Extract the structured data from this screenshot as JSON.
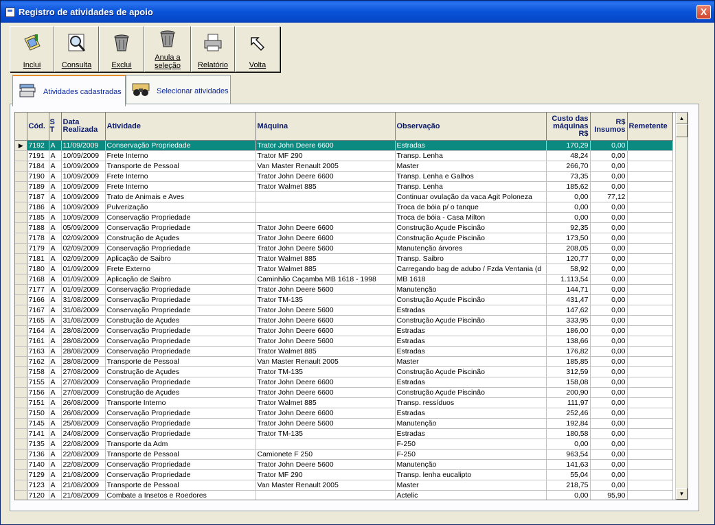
{
  "window": {
    "title": "Registro de atividades de apoio",
    "close_label": "X"
  },
  "toolbar": [
    {
      "label": "Inclui",
      "icon": "add-icon"
    },
    {
      "label": "Consulta",
      "icon": "magnifier-icon"
    },
    {
      "label": "Exclui",
      "icon": "trash-icon"
    },
    {
      "label": "Anula a seleção",
      "icon": "trash-cancel-icon"
    },
    {
      "label": "Relatório",
      "icon": "printer-icon"
    },
    {
      "label": "Volta",
      "icon": "back-arrow-icon"
    }
  ],
  "tabs": [
    {
      "label": "Atividades cadastradas",
      "icon": "records-icon",
      "active": true
    },
    {
      "label": "Selecionar atividades",
      "icon": "binoculars-icon",
      "active": false
    }
  ],
  "grid": {
    "columns": [
      "Cód.",
      "S T",
      "Data Realizada",
      "Atividade",
      "Máquina",
      "Observação",
      "Custo das máquinas R$",
      "R$ Insumos",
      "Remetente"
    ],
    "row_indicator": "▶",
    "rows": [
      [
        "7192",
        "A",
        "11/09/2009",
        "Conservação Propriedade",
        "Trator John Deere 6600",
        "Estradas",
        "170,29",
        "0,00",
        ""
      ],
      [
        "7191",
        "A",
        "10/09/2009",
        "Frete Interno",
        "Trator MF 290",
        "Transp. Lenha",
        "48,24",
        "0,00",
        ""
      ],
      [
        "7184",
        "A",
        "10/09/2009",
        "Transporte de Pessoal",
        "Van Master Renault 2005",
        "Master",
        "266,70",
        "0,00",
        ""
      ],
      [
        "7190",
        "A",
        "10/09/2009",
        "Frete Interno",
        "Trator John Deere 6600",
        "Transp. Lenha e Galhos",
        "73,35",
        "0,00",
        ""
      ],
      [
        "7189",
        "A",
        "10/09/2009",
        "Frete Interno",
        "Trator Walmet 885",
        "Transp. Lenha",
        "185,62",
        "0,00",
        ""
      ],
      [
        "7187",
        "A",
        "10/09/2009",
        "Trato de Animais e Aves",
        "",
        "Continuar ovulação da vaca Agit Poloneza",
        "0,00",
        "77,12",
        ""
      ],
      [
        "7186",
        "A",
        "10/09/2009",
        "Pulverização",
        "",
        "Troca de bóia p/ o tanque",
        "0,00",
        "0,00",
        ""
      ],
      [
        "7185",
        "A",
        "10/09/2009",
        "Conservação Propriedade",
        "",
        "Troca de bóia - Casa Milton",
        "0,00",
        "0,00",
        ""
      ],
      [
        "7188",
        "A",
        "05/09/2009",
        "Conservação Propriedade",
        "Trator John Deere 6600",
        "Construção Açude Piscinão",
        "92,35",
        "0,00",
        ""
      ],
      [
        "7178",
        "A",
        "02/09/2009",
        "Construção de Açudes",
        "Trator John Deere 6600",
        "Construção Açude Piscinão",
        "173,50",
        "0,00",
        ""
      ],
      [
        "7179",
        "A",
        "02/09/2009",
        "Conservação Propriedade",
        "Trator John Deere 5600",
        "Manutenção árvores",
        "208,05",
        "0,00",
        ""
      ],
      [
        "7181",
        "A",
        "02/09/2009",
        "Aplicação de Saibro",
        "Trator Walmet 885",
        "Transp. Saibro",
        "120,77",
        "0,00",
        ""
      ],
      [
        "7180",
        "A",
        "01/09/2009",
        "Frete Externo",
        "Trator Walmet 885",
        "Carregando bag de adubo / Fzda Ventania (d",
        "58,92",
        "0,00",
        ""
      ],
      [
        "7168",
        "A",
        "01/09/2009",
        "Aplicação de Saibro",
        "Caminhão Caçamba MB 1618 - 1998",
        "MB 1618",
        "1.113,54",
        "0,00",
        ""
      ],
      [
        "7177",
        "A",
        "01/09/2009",
        "Conservação Propriedade",
        "Trator John Deere 5600",
        "Manutenção",
        "144,71",
        "0,00",
        ""
      ],
      [
        "7166",
        "A",
        "31/08/2009",
        "Conservação Propriedade",
        "Trator TM-135",
        "Construção Açude Piscinão",
        "431,47",
        "0,00",
        ""
      ],
      [
        "7167",
        "A",
        "31/08/2009",
        "Conservação Propriedade",
        "Trator John Deere 5600",
        "Estradas",
        "147,62",
        "0,00",
        ""
      ],
      [
        "7165",
        "A",
        "31/08/2009",
        "Construção de Açudes",
        "Trator John Deere 6600",
        "Construção Açude Piscinão",
        "333,95",
        "0,00",
        ""
      ],
      [
        "7164",
        "A",
        "28/08/2009",
        "Conservação Propriedade",
        "Trator John Deere 6600",
        "Estradas",
        "186,00",
        "0,00",
        ""
      ],
      [
        "7161",
        "A",
        "28/08/2009",
        "Conservação Propriedade",
        "Trator John Deere 5600",
        "Estradas",
        "138,66",
        "0,00",
        ""
      ],
      [
        "7163",
        "A",
        "28/08/2009",
        "Conservação Propriedade",
        "Trator Walmet 885",
        "Estradas",
        "176,82",
        "0,00",
        ""
      ],
      [
        "7162",
        "A",
        "28/08/2009",
        "Transporte de Pessoal",
        "Van Master Renault 2005",
        "Master",
        "185,85",
        "0,00",
        ""
      ],
      [
        "7158",
        "A",
        "27/08/2009",
        "Construção de Açudes",
        "Trator TM-135",
        "Construção Açude Piscinão",
        "312,59",
        "0,00",
        ""
      ],
      [
        "7155",
        "A",
        "27/08/2009",
        "Conservação Propriedade",
        "Trator John Deere 6600",
        "Estradas",
        "158,08",
        "0,00",
        ""
      ],
      [
        "7156",
        "A",
        "27/08/2009",
        "Construção de Açudes",
        "Trator John Deere 6600",
        "Construção Açude Piscinão",
        "200,90",
        "0,00",
        ""
      ],
      [
        "7151",
        "A",
        "26/08/2009",
        "Transporte Interno",
        "Trator Walmet 885",
        "Transp. ressíduos",
        "111,97",
        "0,00",
        ""
      ],
      [
        "7150",
        "A",
        "26/08/2009",
        "Conservação Propriedade",
        "Trator John Deere 6600",
        "Estradas",
        "252,46",
        "0,00",
        ""
      ],
      [
        "7145",
        "A",
        "25/08/2009",
        "Conservação Propriedade",
        "Trator John Deere 5600",
        "Manutenção",
        "192,84",
        "0,00",
        ""
      ],
      [
        "7141",
        "A",
        "24/08/2009",
        "Conservação Propriedade",
        "Trator TM-135",
        "Estradas",
        "180,58",
        "0,00",
        ""
      ],
      [
        "7135",
        "A",
        "22/08/2009",
        "Transporte da Adm",
        "",
        "F-250",
        "0,00",
        "0,00",
        ""
      ],
      [
        "7136",
        "A",
        "22/08/2009",
        "Transporte de Pessoal",
        "Camionete F 250",
        "F-250",
        "963,54",
        "0,00",
        ""
      ],
      [
        "7140",
        "A",
        "22/08/2009",
        "Conservação Propriedade",
        "Trator John Deere 5600",
        "Manutenção",
        "141,63",
        "0,00",
        ""
      ],
      [
        "7129",
        "A",
        "21/08/2009",
        "Conservação Propriedade",
        "Trator MF 290",
        "Transp. lenha eucalipto",
        "55,04",
        "0,00",
        ""
      ],
      [
        "7123",
        "A",
        "21/08/2009",
        "Transporte de Pessoal",
        "Van Master Renault 2005",
        "Master",
        "218,75",
        "0,00",
        ""
      ],
      [
        "7120",
        "A",
        "21/08/2009",
        "Combate a Insetos e Roedores",
        "",
        "Actelic",
        "0,00",
        "95,90",
        ""
      ]
    ]
  },
  "scrollbar": {
    "up": "▲",
    "down": "▼"
  }
}
